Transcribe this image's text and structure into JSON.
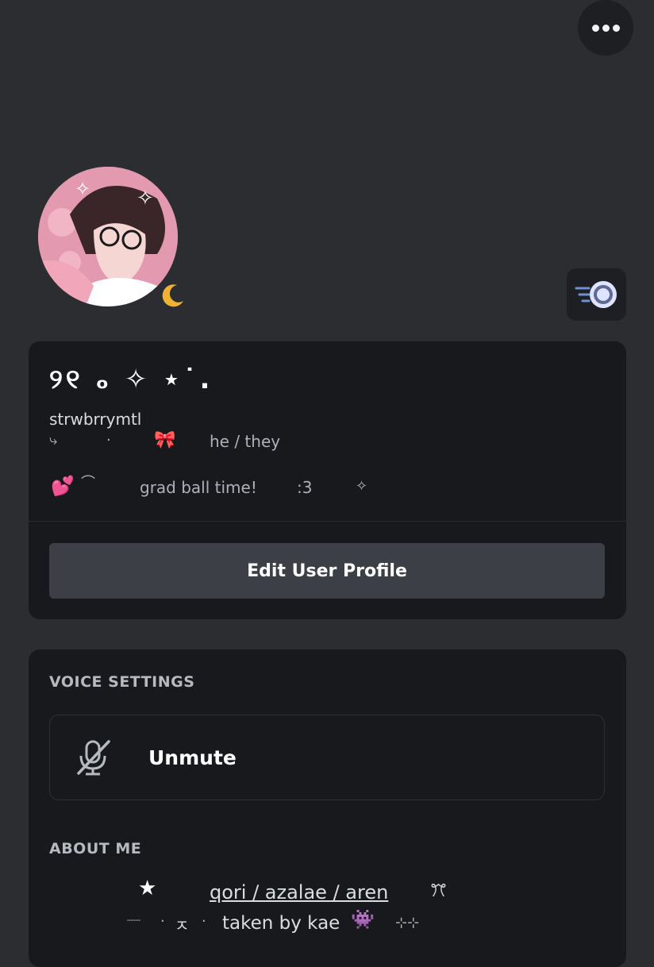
{
  "header": {
    "more_icon": "more-horizontal-icon"
  },
  "profile": {
    "avatar_icon": "profile-avatar",
    "status_icon": "moon-idle-icon",
    "nitro_icon": "nitro-badge-icon",
    "display_name": "୨୧ ₒ ✧ ⋆˙.",
    "username": "strwbrrymtl",
    "pronoun_arrow": "⤷",
    "pronoun_dot": "·",
    "pronoun_bow": "🎀",
    "pronouns": "he / they",
    "status_hearts": "💕",
    "status_curl": "⌒",
    "status_text": "grad ball time!",
    "status_face": ":3",
    "status_sparkle": "✧",
    "edit_button": "Edit User Profile"
  },
  "voice": {
    "section_label": "VOICE SETTINGS",
    "unmute_label": "Unmute",
    "mic_icon": "microphone-muted-icon"
  },
  "about": {
    "section_label": "ABOUT ME",
    "star": "★",
    "names_link": "qori / azalae / aren",
    "ff": "ꔫ",
    "line2_dots": "┈┈",
    "line2_dot_a": "·",
    "line2_kappa": "ㅈ",
    "line2_dot_b": "·",
    "taken_by": "taken by kae",
    "line2_creature": "👾",
    "line2_end": "⊹⊹"
  },
  "colors": {
    "background": "#2b2d31",
    "card": "#18191c",
    "button": "#3c3f45",
    "status_moon": "#f0b232"
  }
}
